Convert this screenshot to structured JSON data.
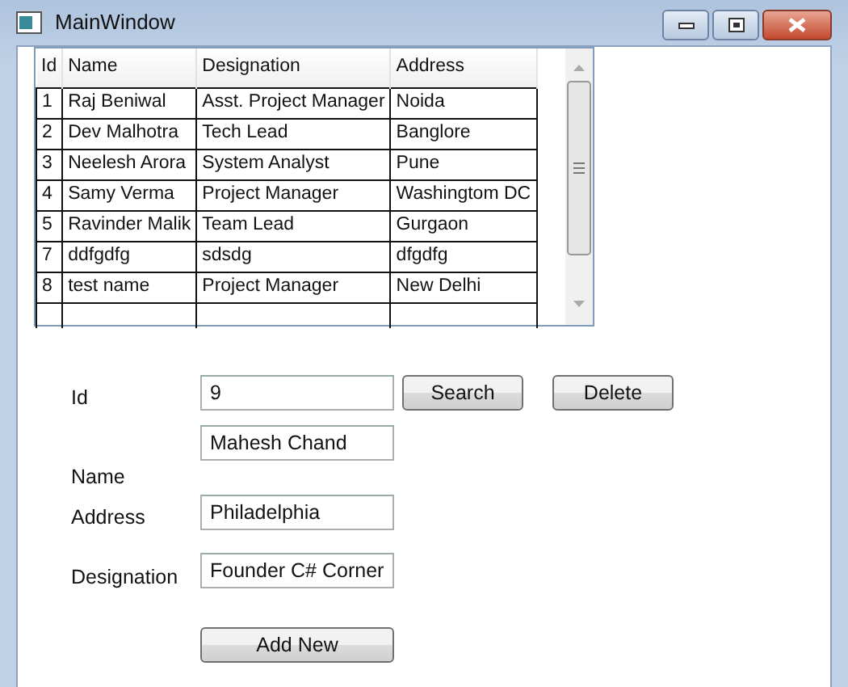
{
  "window": {
    "title": "MainWindow"
  },
  "table": {
    "columns": [
      "Id",
      "Name",
      "Designation",
      "Address"
    ],
    "rows": [
      [
        "1",
        "Raj Beniwal",
        "Asst. Project Manager",
        "Noida"
      ],
      [
        "2",
        "Dev Malhotra",
        "Tech Lead",
        "Banglore"
      ],
      [
        "3",
        "Neelesh Arora",
        "System Analyst",
        "Pune"
      ],
      [
        "4",
        "Samy Verma",
        "Project Manager",
        "Washingtom DC"
      ],
      [
        "5",
        "Ravinder Malik",
        "Team Lead",
        "Gurgaon"
      ],
      [
        "7",
        "ddfgdfg",
        "sdsdg",
        "dfgdfg"
      ],
      [
        "8",
        "test name",
        "Project Manager",
        "New Delhi"
      ]
    ]
  },
  "form": {
    "id": {
      "label": "Id",
      "value": "9"
    },
    "buttons": [
      "Search",
      "Delete"
    ],
    "fields": [
      {
        "label": "Name",
        "value": "Mahesh Chand"
      },
      {
        "label": "Address",
        "value": "Philadelphia"
      },
      {
        "label": "Designation",
        "value": "Founder C# Corner"
      }
    ],
    "add_button": "Add New"
  }
}
